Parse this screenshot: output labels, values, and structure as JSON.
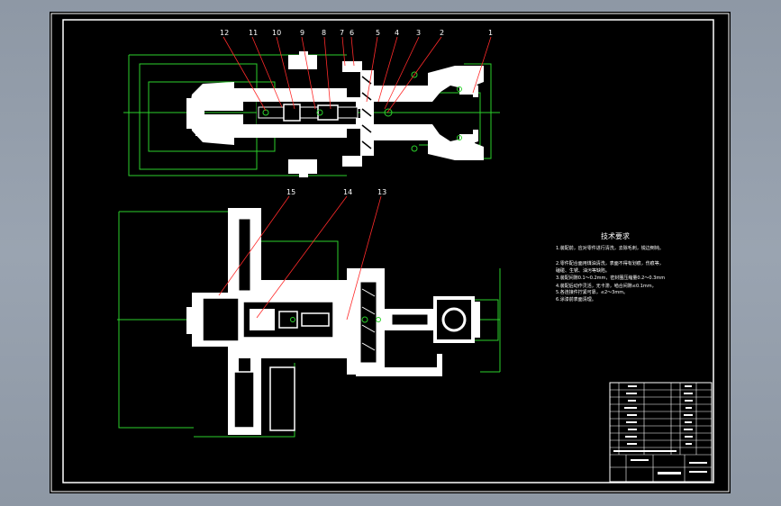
{
  "drawing": {
    "callouts_top": [
      "12",
      "11",
      "10",
      "9",
      "8",
      "7",
      "6",
      "5",
      "4",
      "3",
      "2",
      "1"
    ],
    "callouts_bottom": [
      "15",
      "14",
      "13"
    ],
    "tech_req": {
      "title": "技术要求",
      "lines": [
        "1.装配前，应对零件进行清洗，去除毛刺，锐边倒钝。",
        "2.零件配合面用煤油清洗，表面不得有划痕，伤痕等，",
        "  磕碰、生锈、油污等缺陷。",
        "3.装配间隙0.1～0.2mm，密封圈压缩量0.2～0.3mm",
        "4.装配后动作灵活，无卡滞，啮合间隙≤0.1mm，",
        "5.各连接件拧紧可靠，≤2～3mm。",
        "6.涂漆前表面清理。"
      ]
    }
  }
}
